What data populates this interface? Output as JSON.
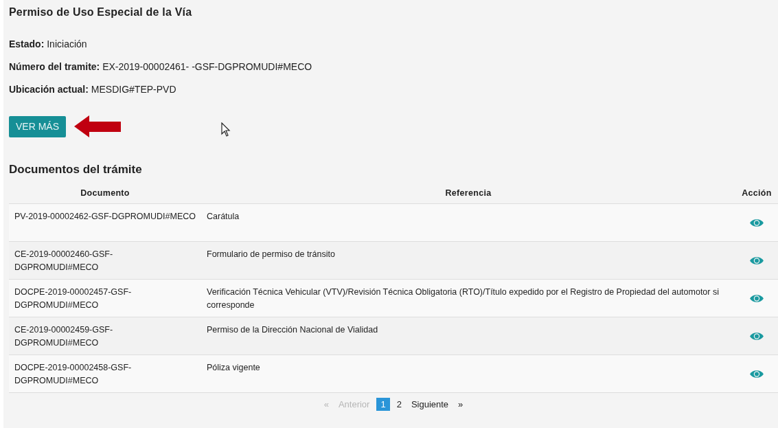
{
  "title": "Permiso de Uso Especial de la Vía",
  "details": [
    {
      "label": "Estado:",
      "value": "Iniciación"
    },
    {
      "label": "Número del tramite:",
      "value": "EX-2019-00002461- -GSF-DGPROMUDI#MECO"
    },
    {
      "label": "Ubicación actual:",
      "value": "MESDIG#TEP-PVD"
    }
  ],
  "more_button": "VER MÁS",
  "documents": {
    "heading": "Documentos del trámite",
    "columns": [
      "Documento",
      "Referencia",
      "Acción"
    ],
    "rows": [
      {
        "documento": "PV-2019-00002462-GSF-DGPROMUDI#MECO",
        "referencia": "Carátula"
      },
      {
        "documento": "CE-2019-00002460-GSF-DGPROMUDI#MECO",
        "referencia": "Formulario de permiso de tránsito"
      },
      {
        "documento": "DOCPE-2019-00002457-GSF-DGPROMUDI#MECO",
        "referencia": "Verificación Técnica Vehicular (VTV)/Revisión Técnica Obligatoria (RTO)/Título expedido por el Registro de Propiedad del automotor si corresponde"
      },
      {
        "documento": "CE-2019-00002459-GSF-DGPROMUDI#MECO",
        "referencia": "Permiso de la Dirección Nacional de Vialidad"
      },
      {
        "documento": "DOCPE-2019-00002458-GSF-DGPROMUDI#MECO",
        "referencia": "Póliza vigente"
      }
    ]
  },
  "pagination": {
    "previous": {
      "arrow": "«",
      "label": "Anterior",
      "disabled": true
    },
    "pages": [
      {
        "label": "1",
        "selected": true
      },
      {
        "label": "2",
        "selected": false
      }
    ],
    "next": {
      "label": "Siguiente",
      "arrow": "»",
      "disabled": false
    }
  }
}
